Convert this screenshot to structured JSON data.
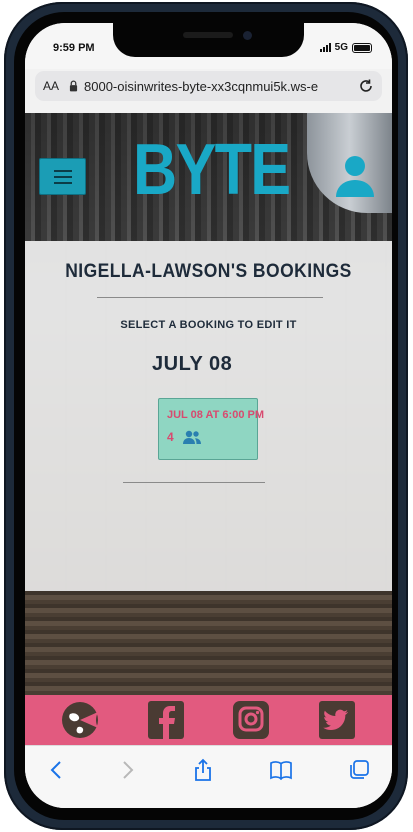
{
  "status_bar": {
    "time": "9:59 PM",
    "network": "5G"
  },
  "browser": {
    "text_size_label": "AA",
    "url": "8000-oisinwrites-byte-xx3cqnmui5k.ws-e"
  },
  "header": {
    "logo_text": "BYTE"
  },
  "bookings_page": {
    "title": "NIGELLA-LAWSON'S BOOKINGS",
    "subtitle": "SELECT A BOOKING TO EDIT IT",
    "groups": [
      {
        "date": "JULY 08",
        "bookings": [
          {
            "datetime": "JUL 08 AT 6:00 PM",
            "guests": "4"
          }
        ]
      }
    ]
  },
  "footer": {
    "links": [
      "pacman-globe-icon",
      "facebook-icon",
      "instagram-icon",
      "twitter-icon"
    ]
  },
  "colors": {
    "accent": "#19a8c6",
    "booking_card": "#8fd6c2",
    "booking_text": "#d84a6f",
    "footer_bg": "#e25a7f",
    "heading": "#1e2b3a"
  }
}
